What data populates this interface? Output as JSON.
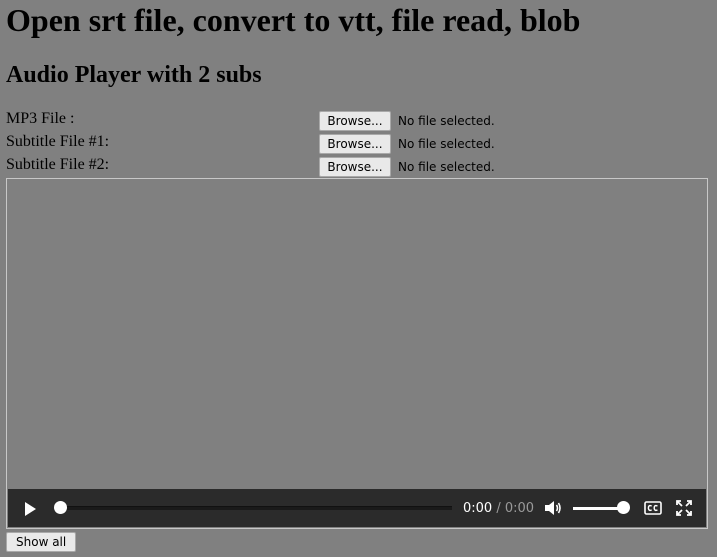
{
  "page": {
    "title": "Open srt file, convert to vtt, file read, blob",
    "subtitle": "Audio Player with 2 subs"
  },
  "file_inputs": [
    {
      "label": "MP3 File :",
      "button": "Browse...",
      "status": "No file selected."
    },
    {
      "label": "Subtitle File #1:",
      "button": "Browse...",
      "status": "No file selected."
    },
    {
      "label": "Subtitle File #2:",
      "button": "Browse...",
      "status": "No file selected."
    }
  ],
  "player": {
    "current_time": "0:00",
    "separator": "/",
    "duration": "0:00",
    "progress": 0,
    "volume": 1.0,
    "icons": {
      "play": "play-icon",
      "volume": "volume-icon",
      "captions": "closed-captions-icon",
      "fullscreen": "fullscreen-icon"
    }
  },
  "show_all_button": "Show all",
  "colors": {
    "page_background": "#808080",
    "control_bar": "#2b2b2b",
    "button_face": "#e9e9e9"
  }
}
